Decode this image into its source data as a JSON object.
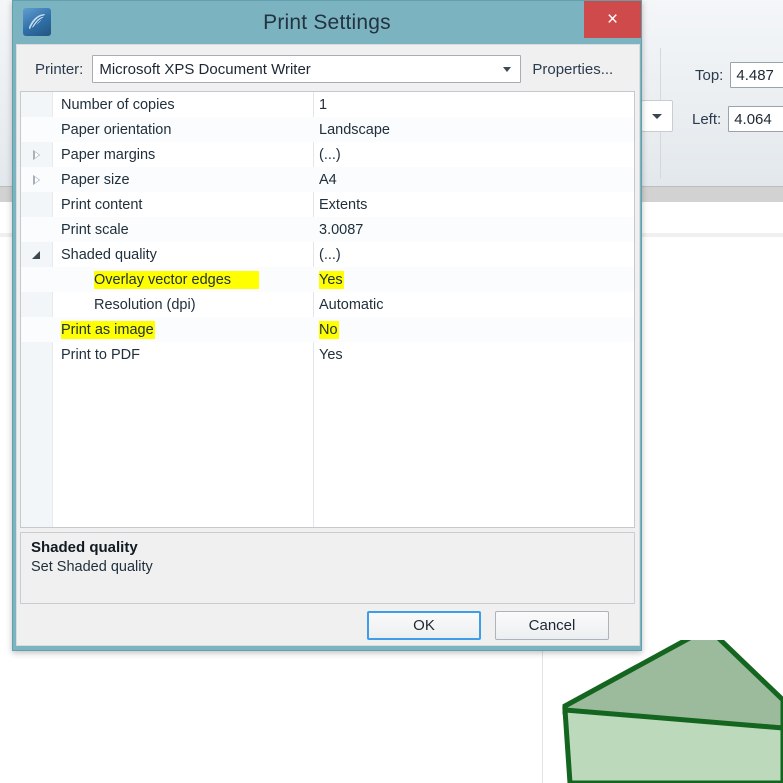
{
  "background": {
    "fields": [
      {
        "label": "Top:",
        "value": "4.487"
      },
      {
        "label": "Left:",
        "value": "4.064"
      }
    ],
    "dropdown_icon": "chevron-down-icon"
  },
  "dialog": {
    "title": "Print Settings",
    "app_icon": "application-icon",
    "close_label": "×",
    "printer": {
      "label": "Printer:",
      "value": "Microsoft XPS Document Writer",
      "dropdown_icon": "chevron-down-icon",
      "properties_label": "Properties..."
    },
    "properties": [
      {
        "label": "Number of copies",
        "value": "1",
        "twisty": "none",
        "indent": "normal",
        "hl_label": false,
        "hl_value": false
      },
      {
        "label": "Paper orientation",
        "value": "Landscape",
        "twisty": "none",
        "indent": "normal",
        "hl_label": false,
        "hl_value": false
      },
      {
        "label": "Paper margins",
        "value": "(...)",
        "twisty": "collapsed",
        "indent": "normal",
        "hl_label": false,
        "hl_value": false
      },
      {
        "label": "Paper size",
        "value": "A4",
        "twisty": "collapsed",
        "indent": "normal",
        "hl_label": false,
        "hl_value": false
      },
      {
        "label": "Print content",
        "value": "Extents",
        "twisty": "none",
        "indent": "normal",
        "hl_label": false,
        "hl_value": false
      },
      {
        "label": "Print scale",
        "value": "3.0087",
        "twisty": "none",
        "indent": "normal",
        "hl_label": false,
        "hl_value": false
      },
      {
        "label": "Shaded quality",
        "value": "(...)",
        "twisty": "expanded",
        "indent": "normal",
        "hl_label": false,
        "hl_value": false
      },
      {
        "label": "Overlay vector edges",
        "value": "Yes",
        "twisty": "none",
        "indent": "child",
        "hl_label": true,
        "hl_value": true
      },
      {
        "label": "Resolution (dpi)",
        "value": "Automatic",
        "twisty": "none",
        "indent": "child",
        "hl_label": false,
        "hl_value": false
      },
      {
        "label": "Print as image",
        "value": "No",
        "twisty": "none",
        "indent": "normal",
        "hl_label": true,
        "hl_value": true
      },
      {
        "label": "Print to PDF",
        "value": "Yes",
        "twisty": "none",
        "indent": "normal",
        "hl_label": false,
        "hl_value": false
      }
    ],
    "description": {
      "title": "Shaded quality",
      "text": "Set Shaded quality"
    },
    "buttons": {
      "ok": "OK",
      "cancel": "Cancel"
    }
  },
  "colors": {
    "dialog_frame": "#7cb3c0",
    "close_button": "#cf4b4b",
    "highlight": "#ffff00",
    "focus_border": "#3f9ce8",
    "solid_top_face": "#9cbb9c",
    "solid_front_face": "#bcd9bc",
    "solid_edge": "#14651f"
  }
}
